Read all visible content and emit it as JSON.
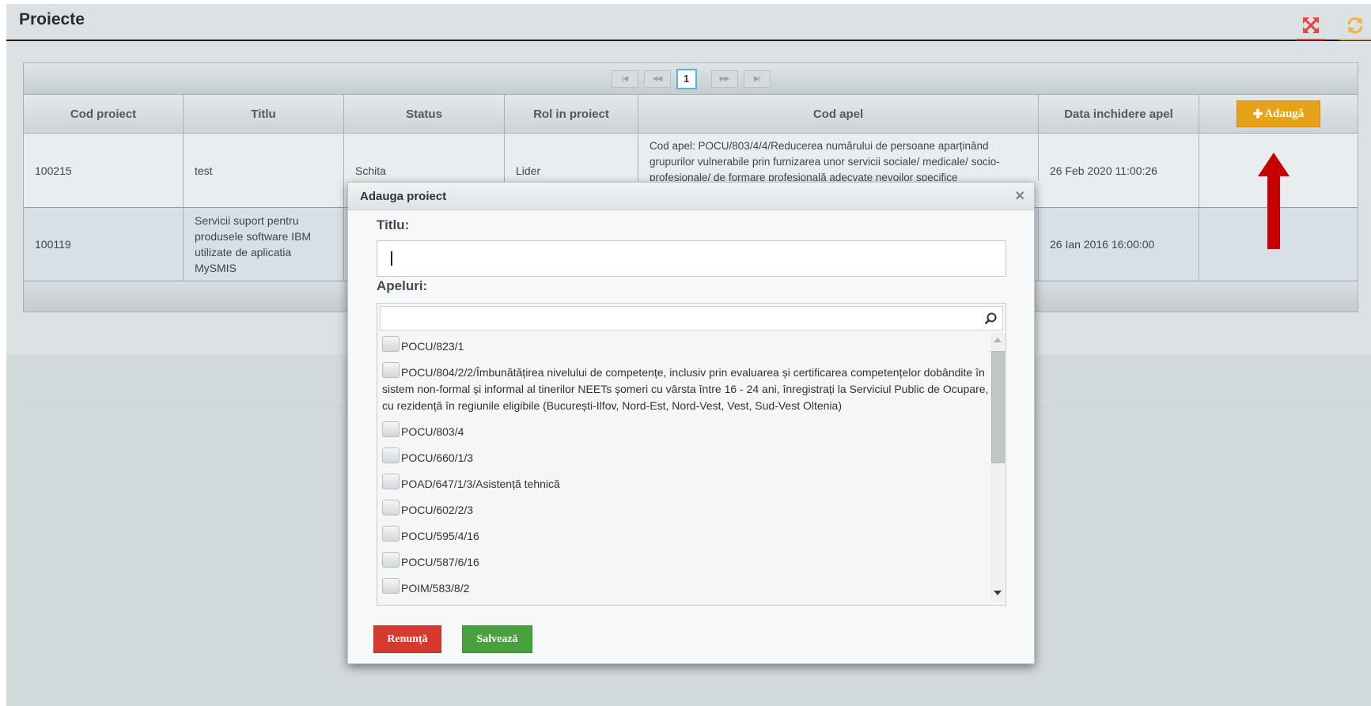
{
  "page": {
    "title": "Proiecte"
  },
  "toolbar": {
    "expand_icon": "expand-arrows-icon",
    "refresh_icon": "refresh-icon"
  },
  "pager": {
    "first": "|◀",
    "prev": "◀◀",
    "current": "1",
    "next": "▶▶",
    "last": "▶|"
  },
  "table": {
    "columns": [
      "Cod proiect",
      "Titlu",
      "Status",
      "Rol in proiect",
      "Cod apel",
      "Data inchidere apel"
    ],
    "add_button_label": "Adaugă",
    "rows": [
      {
        "cod": "100215",
        "titlu": "test",
        "status": "Schita",
        "rol": "Lider",
        "apel": "Cod apel: POCU/803/4/4/Reducerea numărului de persoane aparținând grupurilor vulnerabile prin furnizarea unor servicii sociale/ medicale/ socio-profesionale/ de formare profesională adecvate nevoilor specifice",
        "data": "26 Feb 2020 11:00:26"
      },
      {
        "cod": "100119",
        "titlu": "Servicii suport pentru produsele software IBM utilizate de aplicatia MySMIS",
        "status": "",
        "rol": "",
        "apel": "",
        "data": "26 Ian 2016 16:00:00"
      }
    ]
  },
  "modal": {
    "title": "Adauga proiect",
    "close_label": "×",
    "titlu_label": "Titlu:",
    "titlu_value": "",
    "apeluri_label": "Apeluri:",
    "search_value": "",
    "calls": [
      "POCU/823/1",
      "POCU/804/2/2/Îmbunătățirea nivelului de competențe, inclusiv prin evaluarea și certificarea competențelor dobândite în sistem non-formal și informal al tinerilor NEETs șomeri cu vârsta între 16 - 24 ani, înregistrați la Serviciul Public de Ocupare, cu rezidență în regiunile eligibile (București-Ilfov, Nord-Est, Nord-Vest, Vest, Sud-Vest Oltenia)",
      "POCU/803/4",
      "POCU/660/1/3",
      "POAD/647/1/3/Asistență tehnică",
      "POCU/602/2/3",
      "POCU/595/4/16",
      "POCU/587/6/16",
      "POIM/583/8/2"
    ],
    "cancel_label": "Renunță",
    "save_label": "Salvează"
  },
  "colors": {
    "add_button": "#e8a21a",
    "cancel_button": "#d63a2f",
    "save_button": "#49a03e",
    "arrow": "#c40000"
  }
}
